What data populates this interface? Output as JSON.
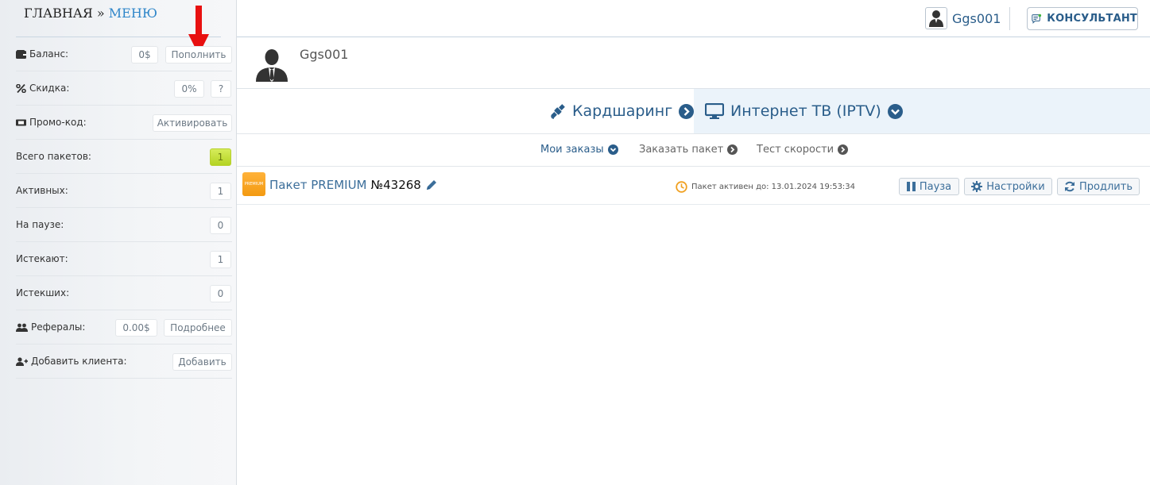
{
  "sidebar": {
    "header": {
      "home": "ГЛАВНАЯ",
      "separator": "»",
      "menu": "МЕНЮ"
    },
    "rows": [
      {
        "label": "Баланс:",
        "value": "0$",
        "action": "Пополнить"
      },
      {
        "label": "Скидка:",
        "value": "0%",
        "action": "?"
      },
      {
        "label": "Промо-код:",
        "action": "Активировать"
      },
      {
        "label": "Всего пакетов:",
        "value": "1"
      },
      {
        "label": "Активных:",
        "value": "1"
      },
      {
        "label": "На паузе:",
        "value": "0"
      },
      {
        "label": "Истекают:",
        "value": "1"
      },
      {
        "label": "Истекших:",
        "value": "0"
      },
      {
        "label": "Рефералы:",
        "value": "0.00$",
        "action": "Подробнее"
      },
      {
        "label": "Добавить клиента:",
        "action": "Добавить"
      }
    ]
  },
  "topbar": {
    "username": "Ggs001",
    "consultant": "КОНСУЛЬТАНТ"
  },
  "profile": {
    "name": "Ggs001"
  },
  "services": [
    {
      "label": "Кардшаринг",
      "icon": "satellite-icon"
    },
    {
      "label": "Интернет ТВ (IPTV)",
      "icon": "monitor-icon"
    }
  ],
  "subtabs": [
    {
      "label": "Мои заказы",
      "icon": "chevron-down-circle-icon"
    },
    {
      "label": "Заказать пакет",
      "icon": "chevron-right-circle-icon"
    },
    {
      "label": "Тест скорости",
      "icon": "chevron-right-circle-icon"
    }
  ],
  "package": {
    "logo_text": "PREMIUM",
    "title": "Пакет PREMIUM",
    "number": "№43268",
    "status": "Пакет активен до: 13.01.2024 19:53:34",
    "buttons": {
      "pause": "Пауза",
      "settings": "Настройки",
      "extend": "Продлить"
    }
  },
  "colors": {
    "accent": "#2a5d8a",
    "link": "#2f86c9",
    "arrow": "#e81010",
    "badge_green": "#c3df3a",
    "package_orange": "#f5a623",
    "clock": "#f0a020"
  }
}
